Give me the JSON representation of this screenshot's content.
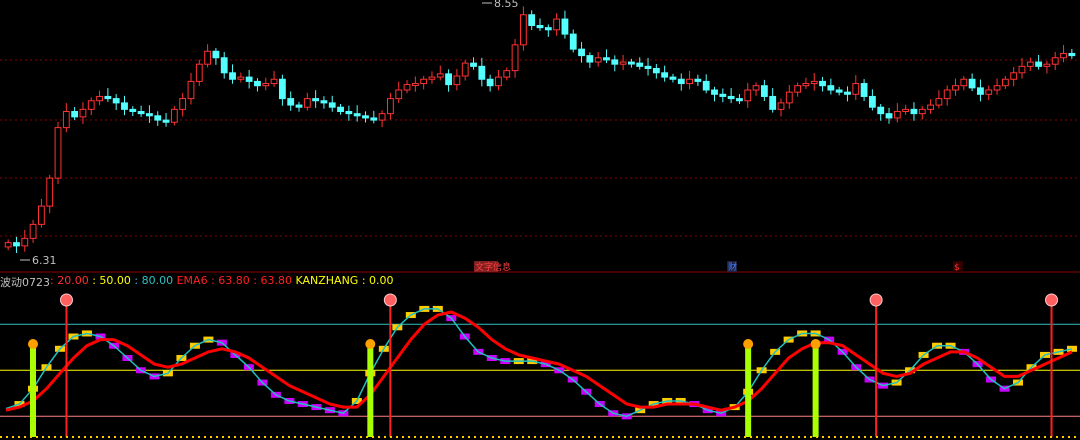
{
  "indicator_bar": {
    "name": "波动0723",
    "sep": " : ",
    "items": [
      {
        "label": "",
        "value": "20.00",
        "color": "#ff3030"
      },
      {
        "label": "",
        "value": "50.00",
        "color": "#ffff00"
      },
      {
        "label": "",
        "value": "80.00",
        "color": "#30c0c0"
      },
      {
        "label": "EMA6",
        "value": "63.80",
        "color": "#ff2020"
      },
      {
        "label": "",
        "value": "63.80",
        "color": "#ff2020"
      },
      {
        "label": "KANZHANG",
        "value": "0.00",
        "color": "#ffff00"
      }
    ]
  },
  "price_labels": {
    "high": "8.55",
    "low": "6.31"
  },
  "event_markers": [
    {
      "text": "文字信息",
      "color": "#ff4040",
      "bg": "#802020"
    },
    {
      "text": "财",
      "color": "#4080ff",
      "bg": "#202040"
    },
    {
      "text": "$",
      "color": "#ff3030",
      "bg": "#300000"
    }
  ],
  "colors": {
    "up": "#ff3232",
    "down": "#54ffff",
    "grid": "#8b0000",
    "ema": "#ff0000",
    "osc_up": "#ffcc00",
    "osc_down": "#cc00ff",
    "slow": "#20c0c0",
    "signal_buy": "#aaff00",
    "signal_sell": "#ff2020"
  },
  "chart_data": [
    {
      "type": "candlestick",
      "title": "",
      "ylim": [
        6.2,
        8.6
      ],
      "y_high_label": 8.55,
      "y_low_label": 6.31,
      "close": [
        6.38,
        6.35,
        6.42,
        6.55,
        6.72,
        6.98,
        7.45,
        7.6,
        7.55,
        7.62,
        7.7,
        7.74,
        7.72,
        7.68,
        7.62,
        7.6,
        7.58,
        7.56,
        7.52,
        7.5,
        7.62,
        7.72,
        7.88,
        8.04,
        8.16,
        8.1,
        7.96,
        7.9,
        7.92,
        7.88,
        7.84,
        7.86,
        7.9,
        7.72,
        7.66,
        7.64,
        7.72,
        7.7,
        7.68,
        7.64,
        7.6,
        7.58,
        7.56,
        7.54,
        7.52,
        7.58,
        7.72,
        7.8,
        7.85,
        7.86,
        7.9,
        7.92,
        7.95,
        7.85,
        7.93,
        8.05,
        8.02,
        7.9,
        7.84,
        7.92,
        7.98,
        8.22,
        8.5,
        8.4,
        8.38,
        8.36,
        8.46,
        8.32,
        8.18,
        8.12,
        8.06,
        8.1,
        8.08,
        8.04,
        8.06,
        8.05,
        8.02,
        8.0,
        7.96,
        7.92,
        7.9,
        7.86,
        7.9,
        7.88,
        7.8,
        7.76,
        7.74,
        7.72,
        7.7,
        7.8,
        7.84,
        7.74,
        7.62,
        7.68,
        7.78,
        7.84,
        7.86,
        7.88,
        7.84,
        7.8,
        7.78,
        7.76,
        7.86,
        7.74,
        7.64,
        7.58,
        7.54,
        7.6,
        7.62,
        7.58,
        7.62,
        7.66,
        7.72,
        7.8,
        7.84,
        7.9,
        7.82,
        7.76,
        7.8,
        7.84,
        7.9,
        7.96,
        8.02,
        8.06,
        8.02,
        8.04,
        8.1,
        8.14,
        8.12
      ],
      "tick_labels": [
        "8.55",
        "6.31"
      ]
    },
    {
      "type": "line",
      "title": "",
      "ylim": [
        0,
        100
      ],
      "reference_lines": [
        20,
        50,
        80
      ],
      "series": [
        {
          "name": "EMA6",
          "values": [
            25,
            28,
            38,
            52,
            64,
            72,
            74,
            72,
            66,
            58,
            50,
            46,
            48,
            58,
            66,
            70,
            68,
            60,
            52,
            42,
            34,
            30,
            28,
            26,
            24,
            22,
            30,
            48,
            64,
            78,
            86,
            90,
            90,
            84,
            72,
            62,
            58,
            56,
            56,
            56,
            54,
            50,
            44,
            36,
            28,
            22,
            20,
            24,
            28,
            30,
            30,
            28,
            24,
            22,
            26,
            36,
            50,
            62,
            70,
            74,
            74,
            70,
            62,
            52,
            44,
            40,
            42,
            50,
            60,
            66,
            66,
            62,
            54,
            44,
            38,
            42,
            52,
            60,
            62,
            64
          ]
        },
        {
          "name": "",
          "values": [
            24,
            26,
            30,
            38,
            48,
            58,
            66,
            70,
            70,
            66,
            60,
            54,
            52,
            54,
            58,
            62,
            64,
            62,
            58,
            52,
            46,
            40,
            36,
            32,
            28,
            26,
            26,
            34,
            46,
            58,
            70,
            80,
            86,
            88,
            84,
            78,
            70,
            64,
            60,
            58,
            56,
            54,
            50,
            46,
            40,
            34,
            28,
            26,
            26,
            28,
            28,
            28,
            26,
            24,
            26,
            30,
            38,
            48,
            58,
            64,
            68,
            68,
            66,
            60,
            54,
            48,
            46,
            48,
            54,
            58,
            62,
            62,
            58,
            52,
            46,
            46,
            50,
            54,
            58,
            62
          ]
        }
      ],
      "buy_signals": [
        2,
        27,
        55,
        60
      ],
      "sell_signals": [
        3,
        27,
        63,
        76
      ]
    }
  ]
}
